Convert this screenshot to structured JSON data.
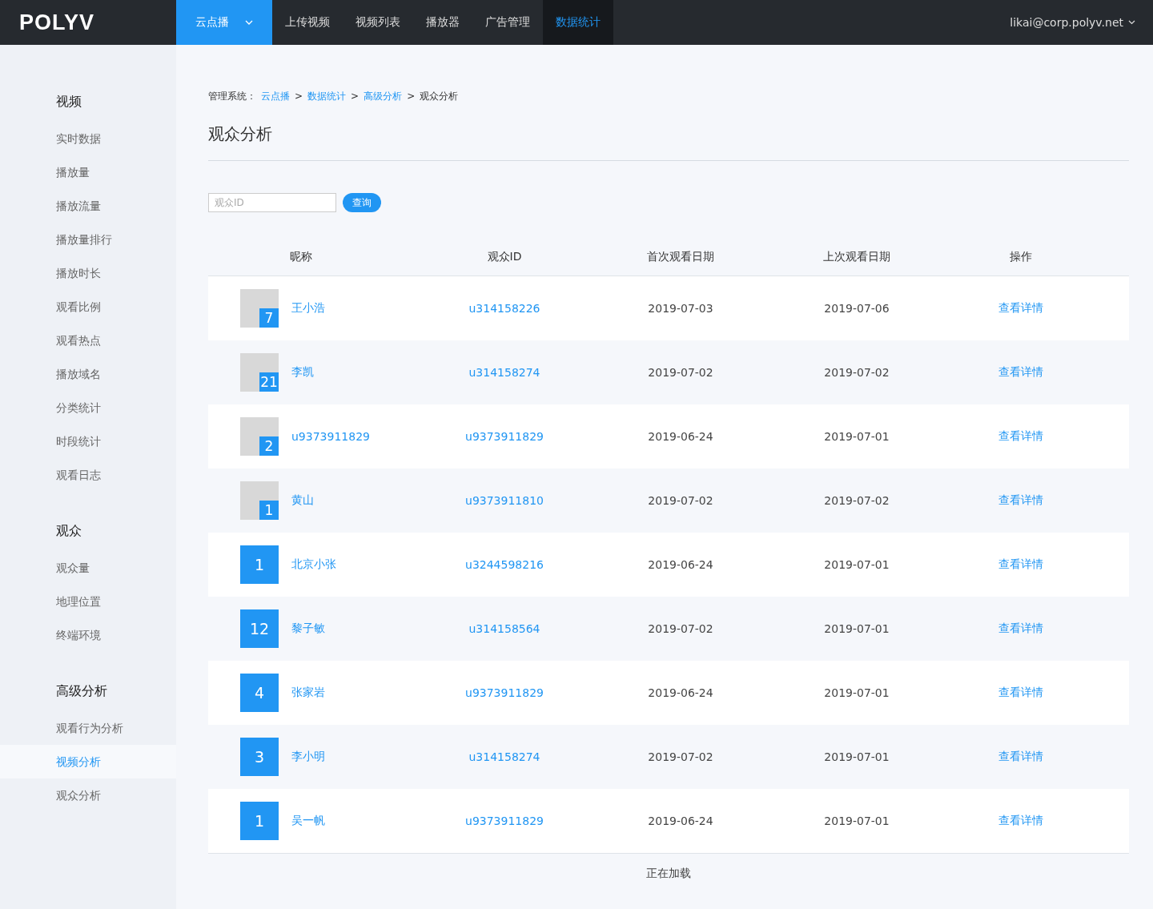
{
  "header": {
    "logo": "POLYV",
    "product": {
      "label": "云点播",
      "expanded": false
    },
    "nav": [
      {
        "label": "上传视频",
        "selected": false
      },
      {
        "label": "视频列表",
        "selected": false
      },
      {
        "label": "播放器",
        "selected": false
      },
      {
        "label": "广告管理",
        "selected": false
      },
      {
        "label": "数据统计",
        "selected": true
      }
    ],
    "account": "likai@corp.polyv.net"
  },
  "sidebar": {
    "groups": [
      {
        "title": "视频",
        "items": [
          {
            "label": "实时数据",
            "selected": false
          },
          {
            "label": "播放量",
            "selected": false
          },
          {
            "label": "播放流量",
            "selected": false
          },
          {
            "label": "播放量排行",
            "selected": false
          },
          {
            "label": "播放时长",
            "selected": false
          },
          {
            "label": "观看比例",
            "selected": false
          },
          {
            "label": "观看热点",
            "selected": false
          },
          {
            "label": "播放域名",
            "selected": false
          },
          {
            "label": "分类统计",
            "selected": false
          },
          {
            "label": "时段统计",
            "selected": false
          },
          {
            "label": "观看日志",
            "selected": false
          }
        ]
      },
      {
        "title": "观众",
        "items": [
          {
            "label": "观众量",
            "selected": false
          },
          {
            "label": "地理位置",
            "selected": false
          },
          {
            "label": "终端环境",
            "selected": false
          }
        ]
      },
      {
        "title": "高级分析",
        "items": [
          {
            "label": "观看行为分析",
            "selected": false
          },
          {
            "label": "视频分析",
            "selected": true
          },
          {
            "label": "观众分析",
            "selected": false
          }
        ]
      }
    ]
  },
  "breadcrumb": [
    {
      "kind": "label",
      "text": "管理系统："
    },
    {
      "kind": "link",
      "text": "云点播"
    },
    {
      "kind": "sep",
      "text": ">"
    },
    {
      "kind": "link",
      "text": "数据统计"
    },
    {
      "kind": "sep",
      "text": ">"
    },
    {
      "kind": "link",
      "text": "高级分析"
    },
    {
      "kind": "sep",
      "text": ">"
    },
    {
      "kind": "current",
      "text": "观众分析"
    }
  ],
  "title": "观众分析",
  "search": {
    "placeholder": "观众ID",
    "button": "查询"
  },
  "table": {
    "columns": [
      "昵称",
      "观众ID",
      "首次观看日期",
      "上次观看日期",
      "操作"
    ],
    "rows": [
      {
        "kind": "photo",
        "badge": "7",
        "nickname": "王小浩",
        "id": "u314158226",
        "first": "2019-07-03",
        "last": "2019-07-06",
        "action": "查看详情"
      },
      {
        "kind": "photo",
        "badge": "21",
        "nickname": "李凯",
        "id": "u314158274",
        "first": "2019-07-02",
        "last": "2019-07-02",
        "action": "查看详情"
      },
      {
        "kind": "photo",
        "badge": "2",
        "nickname": "u9373911829",
        "id": "u9373911829",
        "first": "2019-06-24",
        "last": "2019-07-01",
        "action": "查看详情"
      },
      {
        "kind": "photo",
        "badge": "1",
        "nickname": "黄山",
        "id": "u9373911810",
        "first": "2019-07-02",
        "last": "2019-07-02",
        "action": "查看详情"
      },
      {
        "kind": "number",
        "badge": "1",
        "nickname": "北京小张",
        "id": "u3244598216",
        "first": "2019-06-24",
        "last": "2019-07-01",
        "action": "查看详情"
      },
      {
        "kind": "number",
        "badge": "12",
        "nickname": "黎子敏",
        "id": "u314158564",
        "first": "2019-07-02",
        "last": "2019-07-01",
        "action": "查看详情"
      },
      {
        "kind": "number",
        "badge": "4",
        "nickname": "张家岩",
        "id": "u9373911829",
        "first": "2019-06-24",
        "last": "2019-07-01",
        "action": "查看详情"
      },
      {
        "kind": "number",
        "badge": "3",
        "nickname": "李小明",
        "id": "u314158274",
        "first": "2019-07-02",
        "last": "2019-07-01",
        "action": "查看详情"
      },
      {
        "kind": "number",
        "badge": "1",
        "nickname": "吴一帆",
        "id": "u9373911829",
        "first": "2019-06-24",
        "last": "2019-07-01",
        "action": "查看详情"
      }
    ]
  },
  "loading": "正在加载"
}
